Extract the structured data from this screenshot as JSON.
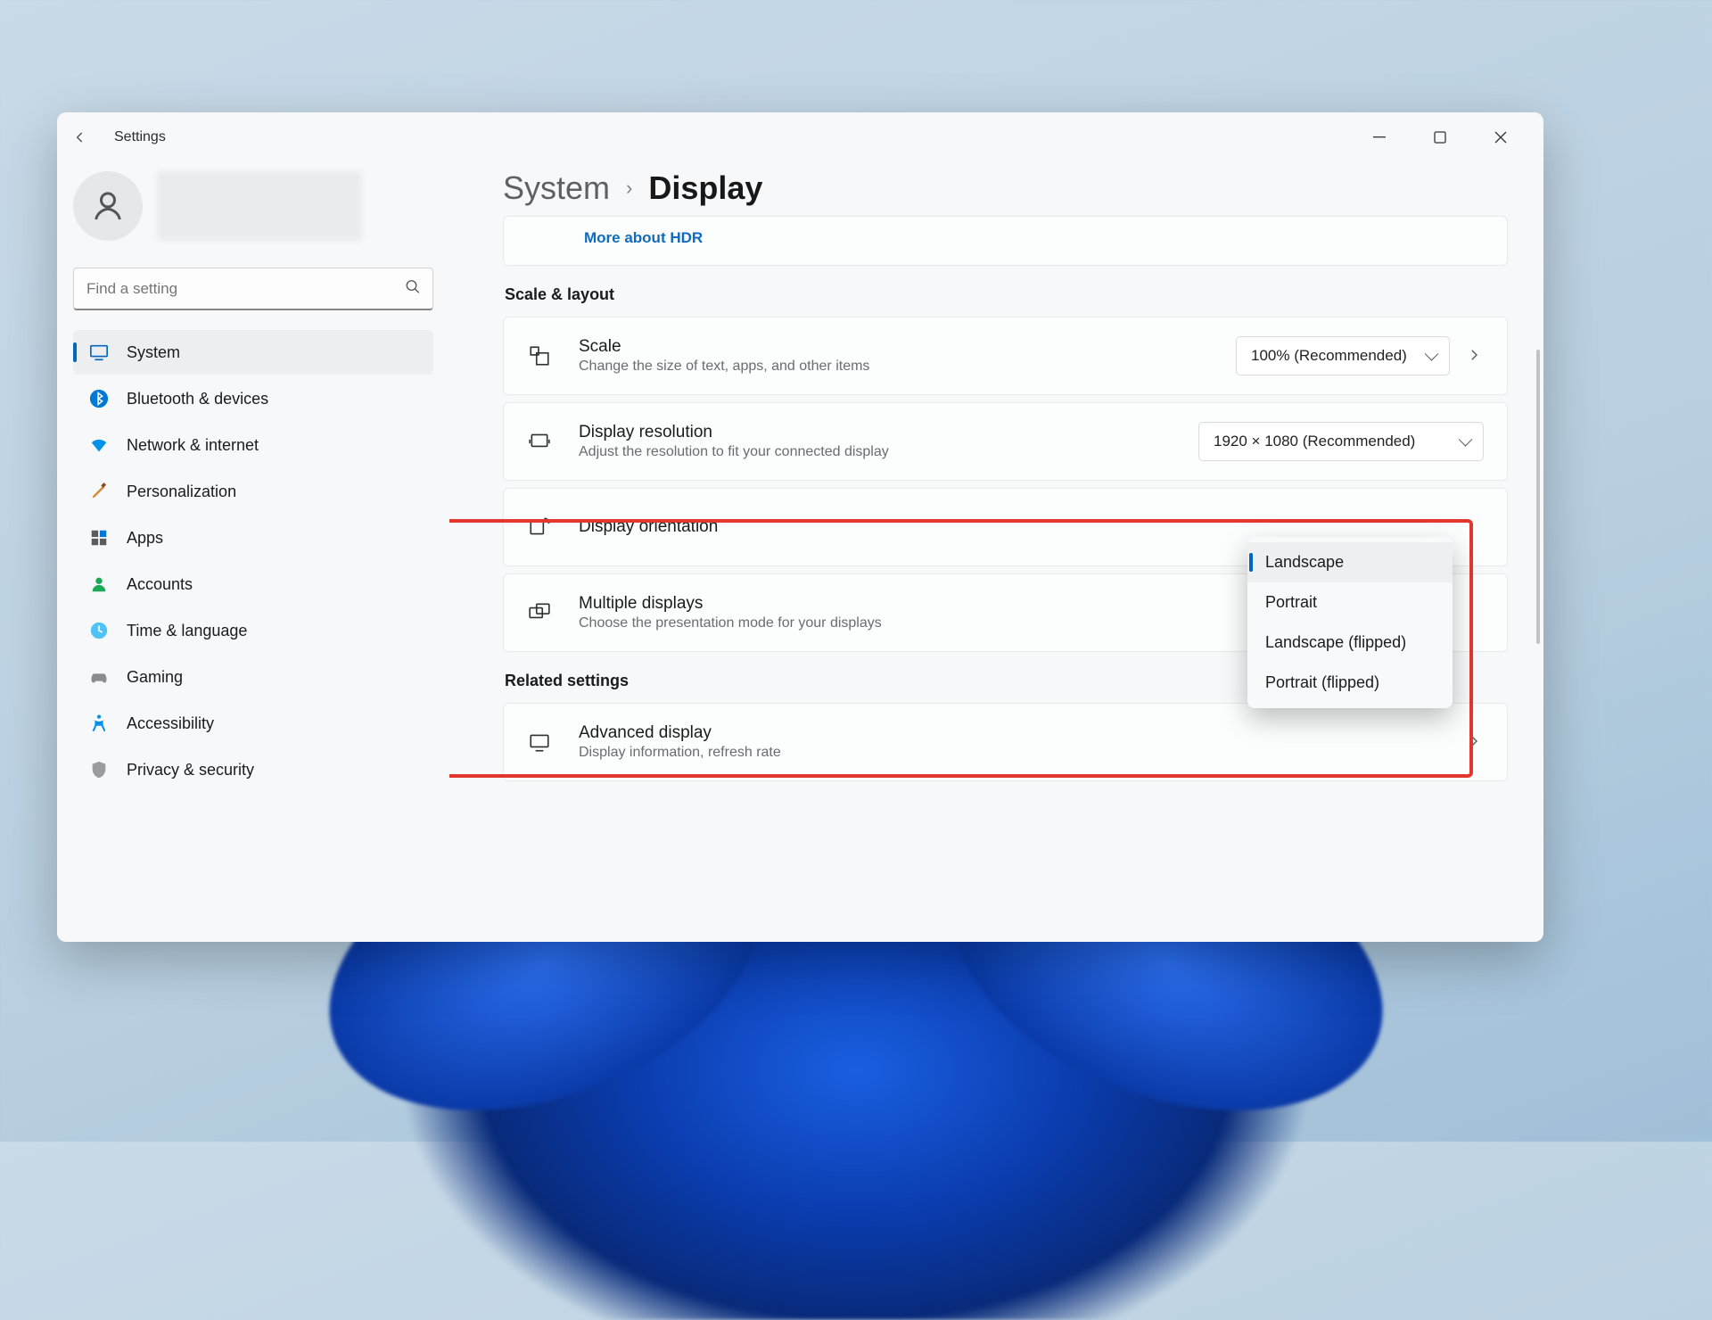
{
  "window": {
    "title": "Settings"
  },
  "breadcrumb": {
    "parent": "System",
    "current": "Display"
  },
  "search": {
    "placeholder": "Find a setting"
  },
  "nav": {
    "items": [
      {
        "label": "System"
      },
      {
        "label": "Bluetooth & devices"
      },
      {
        "label": "Network & internet"
      },
      {
        "label": "Personalization"
      },
      {
        "label": "Apps"
      },
      {
        "label": "Accounts"
      },
      {
        "label": "Time & language"
      },
      {
        "label": "Gaming"
      },
      {
        "label": "Accessibility"
      },
      {
        "label": "Privacy & security"
      }
    ]
  },
  "hdr": {
    "more_link": "More about HDR"
  },
  "sections": {
    "scale_layout": "Scale & layout",
    "related": "Related settings"
  },
  "rows": {
    "scale": {
      "title": "Scale",
      "sub": "Change the size of text, apps, and other items",
      "value": "100% (Recommended)"
    },
    "resolution": {
      "title": "Display resolution",
      "sub": "Adjust the resolution to fit your connected display",
      "value": "1920 × 1080 (Recommended)"
    },
    "orientation": {
      "title": "Display orientation"
    },
    "multiple": {
      "title": "Multiple displays",
      "sub": "Choose the presentation mode for your displays"
    },
    "advanced": {
      "title": "Advanced display",
      "sub": "Display information, refresh rate"
    }
  },
  "orientation_menu": {
    "options": [
      "Landscape",
      "Portrait",
      "Landscape (flipped)",
      "Portrait (flipped)"
    ],
    "selected": "Landscape"
  }
}
